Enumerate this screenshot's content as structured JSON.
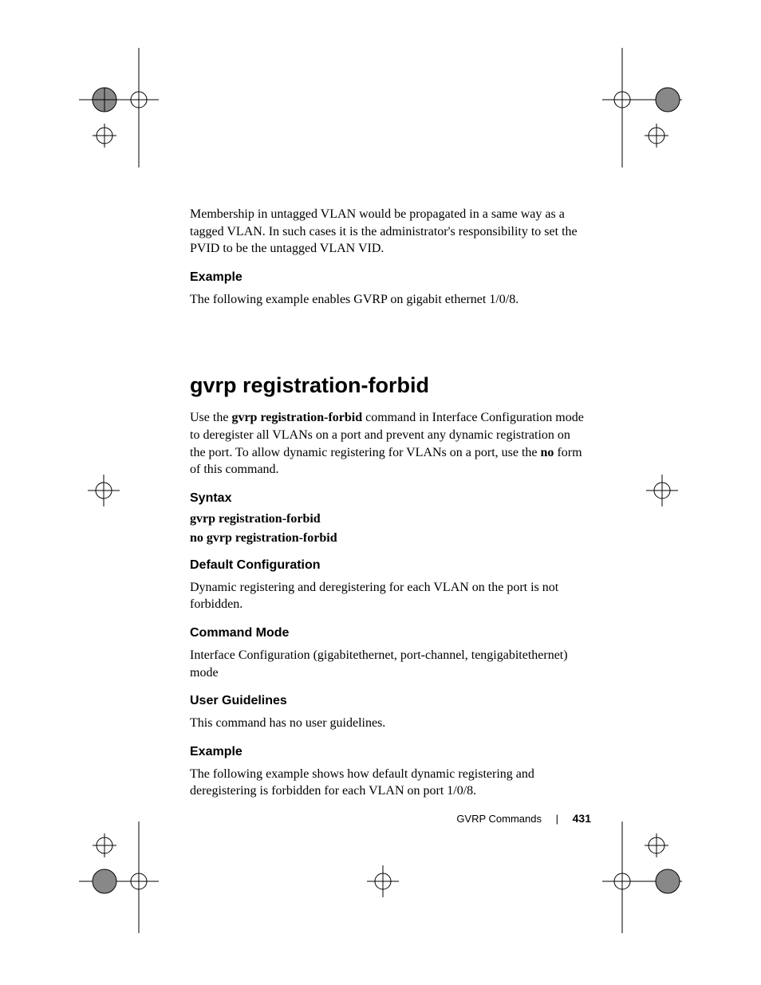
{
  "intro_paragraph": "Membership in untagged VLAN would be propagated in a same way as a tagged VLAN.  In such cases it is the administrator's responsibility to set the PVID to be the untagged VLAN VID.",
  "example1": {
    "heading": "Example",
    "text": "The following example enables GVRP on gigabit ethernet 1/0/8."
  },
  "main_heading": "gvrp registration-forbid",
  "main_desc_pre": "Use the ",
  "main_desc_bold": "gvrp registration-forbid",
  "main_desc_mid": " command  in Interface Configuration mode to deregister all VLANs on a port and prevent any dynamic registration on the port. To allow dynamic registering for VLANs on a port, use the ",
  "main_desc_bold2": "no",
  "main_desc_end": " form of this command.",
  "syntax": {
    "heading": "Syntax",
    "line1": "gvrp registration-forbid",
    "line2": "no gvrp registration-forbid"
  },
  "default_config": {
    "heading": "Default Configuration",
    "text": "Dynamic registering and deregistering for each VLAN on the port is not forbidden."
  },
  "command_mode": {
    "heading": "Command Mode",
    "text": "Interface Configuration (gigabitethernet, port-channel, tengigabitethernet) mode"
  },
  "user_guidelines": {
    "heading": "User Guidelines",
    "text": "This command has no user guidelines."
  },
  "example2": {
    "heading": "Example",
    "text": "The following example shows how default dynamic registering and deregistering is forbidden for each VLAN on port 1/0/8."
  },
  "footer": {
    "label": "GVRP Commands",
    "separator": "|",
    "page": "431"
  }
}
